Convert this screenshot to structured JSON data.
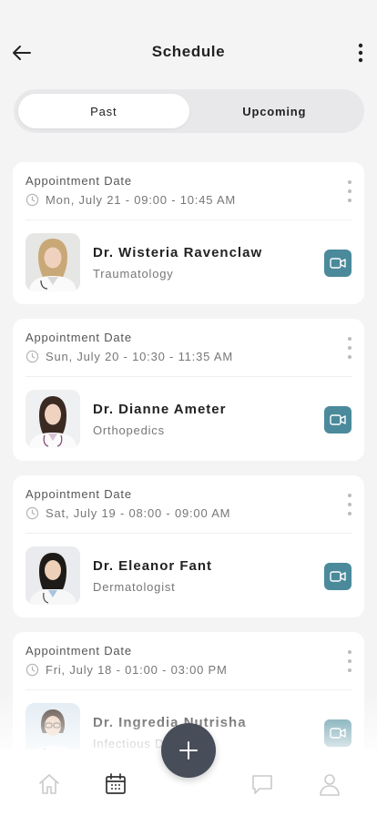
{
  "header": {
    "title": "Schedule"
  },
  "tabs": [
    {
      "label": "Past",
      "active": true
    },
    {
      "label": "Upcoming",
      "active": false
    }
  ],
  "appointments": [
    {
      "date_label": "Appointment Date",
      "date": "Mon, July 21 - 09:00 - 10:45 AM",
      "doctor": "Dr. Wisteria Ravenclaw",
      "specialty": "Traumatology"
    },
    {
      "date_label": "Appointment Date",
      "date": "Sun, July 20 - 10:30 - 11:35 AM",
      "doctor": "Dr. Dianne Ameter",
      "specialty": "Orthopedics"
    },
    {
      "date_label": "Appointment Date",
      "date": "Sat, July 19 - 08:00 - 09:00 AM",
      "doctor": "Dr. Eleanor Fant",
      "specialty": "Dermatologist"
    },
    {
      "date_label": "Appointment Date",
      "date": "Fri, July 18 - 01:00 - 03:00 PM",
      "doctor": "Dr. Ingredia Nutrisha",
      "specialty": "Infectious D"
    }
  ],
  "bottom_nav": {
    "items": [
      "home-icon",
      "calendar-icon",
      "chat-icon",
      "profile-icon"
    ],
    "active": "calendar-icon"
  },
  "colors": {
    "accent": "#4a8a9b",
    "fab": "#474d59",
    "background": "#f4f4f5"
  }
}
